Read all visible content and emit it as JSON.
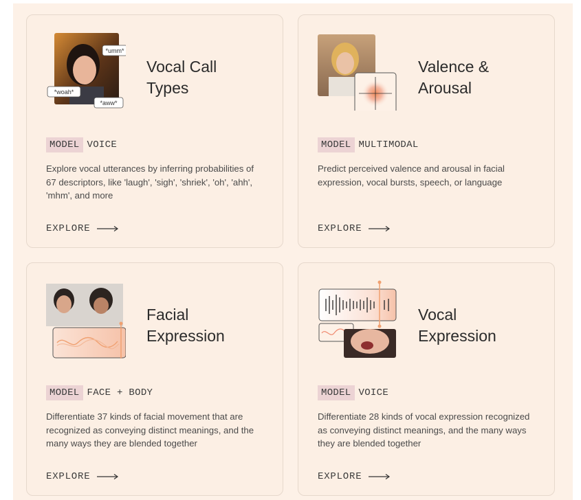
{
  "cards": [
    {
      "title_line1": "Vocal Call",
      "title_line2": "Types",
      "tag": "MODEL",
      "category": "VOICE",
      "description": "Explore vocal utterances by inferring probabilities of 67 descriptors, like 'laugh', 'sigh', 'shriek', 'oh', 'ahh', 'mhm', and more",
      "explore_label": "EXPLORE",
      "bubbles": [
        "*umm*",
        "*woah*",
        "*aww*"
      ]
    },
    {
      "title_line1": "Valence &",
      "title_line2": "Arousal",
      "tag": "MODEL",
      "category": "MULTIMODAL",
      "description": "Predict perceived valence and arousal in facial expression, vocal bursts, speech, or language",
      "explore_label": "EXPLORE"
    },
    {
      "title_line1": "Facial",
      "title_line2": "Expression",
      "tag": "MODEL",
      "category": "FACE + BODY",
      "description": "Differentiate 37 kinds of facial movement that are recognized as conveying distinct meanings, and the many ways they are blended together",
      "explore_label": "EXPLORE"
    },
    {
      "title_line1": "Vocal",
      "title_line2": "Expression",
      "tag": "MODEL",
      "category": "VOICE",
      "description": "Differentiate 28 kinds of vocal expression recognized as conveying distinct meanings, and the many ways they are blended together",
      "explore_label": "EXPLORE"
    }
  ],
  "colors": {
    "background": "#fdf1e7",
    "card": "#fcefe4",
    "tag": "#ecd3d4",
    "accent": "#f0a58a"
  }
}
